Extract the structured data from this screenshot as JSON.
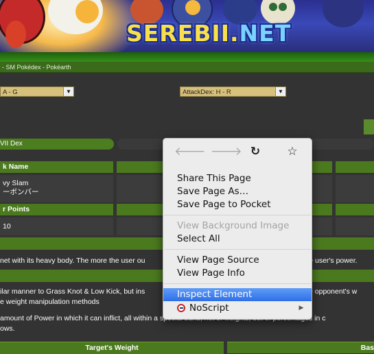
{
  "banner": {
    "logo_main": "SEREBII",
    "logo_dot": ".",
    "logo_net": "NET"
  },
  "breadcrumb": "- SM Pokédex - Pokéarth",
  "selects": {
    "left_value": "A - G",
    "right_value": "AttackDex: H - R"
  },
  "generation_tab": "VII Dex",
  "table": {
    "attack_name_header": "k Name",
    "attack_name_en": "vy Slam",
    "attack_name_jp": "ーボンバー",
    "power_points_header": "r Points",
    "power_points_value": "10"
  },
  "description": "net with its heavy body. The more the user ou",
  "description_tail": "the user's power.",
  "details": {
    "line1": "ilar manner to Grass Knot & Low Kick, but ins",
    "line1_tail": "the opponent's w",
    "line2": "e weight manipulation methods",
    "line3": "amount of Power in which it can inflict, all within a special band, not of weights, but of percentages in c",
    "line4": "ows."
  },
  "weight_table": {
    "target_weight_header": "Target's Weight",
    "base_header": "Bas"
  },
  "context_menu": {
    "nav_icons": [
      "back-arrow-icon",
      "forward-arrow-icon",
      "reload-icon",
      "bookmark-star-icon"
    ],
    "share_page": "Share This Page",
    "save_page_as": "Save Page As…",
    "save_to_pocket": "Save Page to Pocket",
    "view_background": "View Background Image",
    "select_all": "Select All",
    "view_source": "View Page Source",
    "view_info": "View Page Info",
    "inspect": "Inspect Element",
    "noscript": "NoScript",
    "highlight_color": "#3d7ff0"
  },
  "colors": {
    "page_bg": "#333333",
    "header_green": "#4b7a1e",
    "select_tan": "#d7c07a"
  }
}
